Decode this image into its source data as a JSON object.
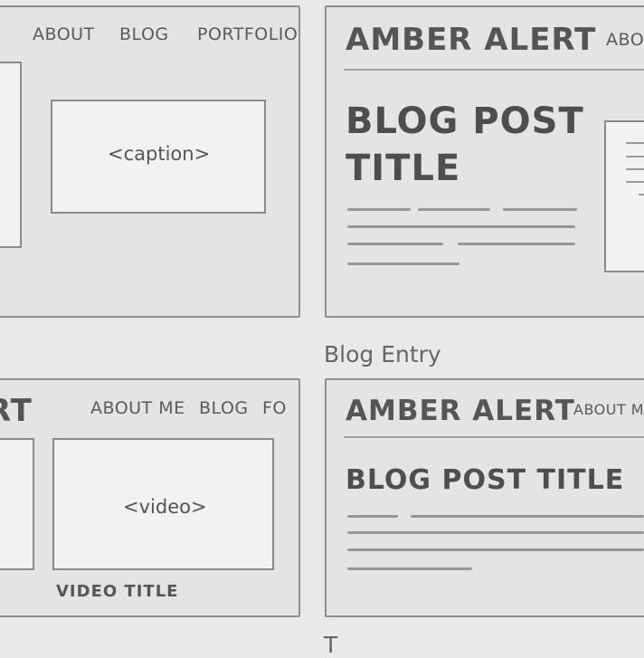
{
  "panel_top_left": {
    "nav": [
      "ABOUT",
      "BLOG",
      "PORTFOLIO"
    ],
    "caption": "<caption>"
  },
  "panel_top_right": {
    "brand": "AMBER ALERT",
    "nav_partial": "ABOU",
    "post_title_line1": "BLOG POST",
    "post_title_line2": "TITLE"
  },
  "labels": {
    "blog_entry": "Blog Entry",
    "bottom_partial": "T"
  },
  "panel_bottom_left": {
    "brand_partial": "RT",
    "nav": [
      "ABOUT ME",
      "BLOG",
      "FO"
    ],
    "video": "<video>",
    "video_title": "VIDEO TITLE"
  },
  "panel_bottom_right": {
    "brand": "AMBER ALERT",
    "nav_partial": "ABOUT ME",
    "post_title": "BLOG POST TITLE"
  }
}
